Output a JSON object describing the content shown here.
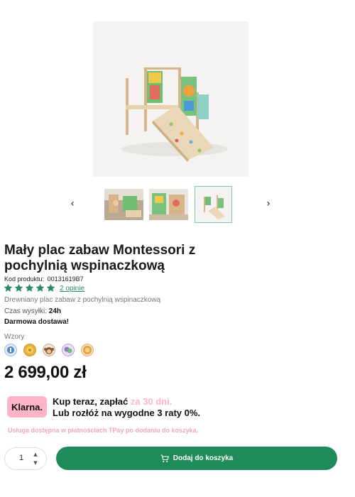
{
  "gallery": {
    "arrow_prev": "‹",
    "arrow_next": "›",
    "selected_thumbnail": 3,
    "thumbnail_count": 3
  },
  "product": {
    "title": "Mały plac zabaw Montessori z pochylnią wspinaczkową",
    "code_label": "Kod produktu:",
    "code_value": "00131619B7",
    "rating_stars": 5,
    "reviews_link": "2 opinie",
    "description": "Drewniany plac zabaw z pochylnią wspinaczkową",
    "shipping_label": "Czas wysyłki:",
    "shipping_value": "24h",
    "free_delivery": "Darmowa dostawa!",
    "patterns_label": "Wzory",
    "pattern_swatches": [
      "blue-pattern",
      "gold-pattern",
      "monkey-pattern",
      "purple-green-pattern",
      "lion-pattern"
    ],
    "price": "2 699,00 zł"
  },
  "klarna": {
    "logo_text": "Klarna.",
    "line1_prefix": "Kup teraz, zapłać",
    "line1_highlight": "za 30 dni.",
    "line2": "Lub rozłóż na wygodne 3 raty 0%.",
    "tpay_note": "Usługa dostępna w płatnościach TPay po dodaniu do koszyka."
  },
  "purchase": {
    "quantity": "1",
    "add_to_cart_label": "Dodaj do koszyka"
  },
  "colors": {
    "accent_green": "#1f8a5a",
    "star_green": "#2c8a63",
    "klarna_pink": "#ffb3c7"
  }
}
